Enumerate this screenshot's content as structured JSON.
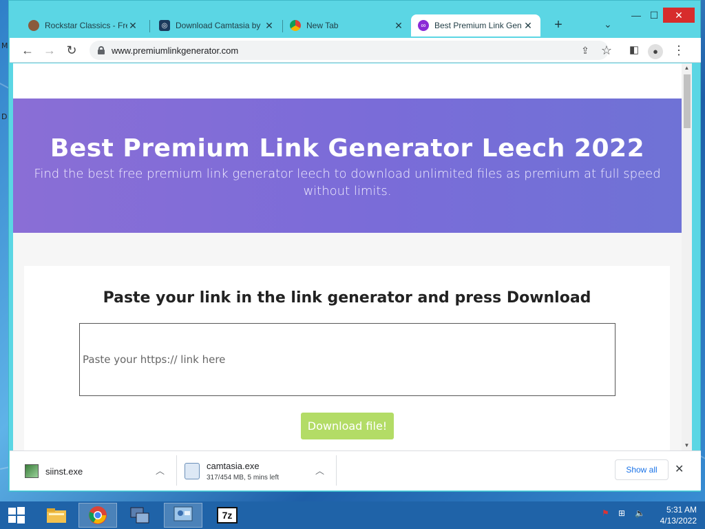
{
  "desktop": {
    "edge_labels": [
      "M",
      "D"
    ]
  },
  "browser": {
    "tabs": [
      {
        "title": "Rockstar Classics - Free",
        "icon": "rockstar-avatar-icon",
        "active": false
      },
      {
        "title": "Download Camtasia by",
        "icon": "camtasia-icon",
        "active": false
      },
      {
        "title": "New Tab",
        "icon": "chrome-icon",
        "active": false
      },
      {
        "title": "Best Premium Link Gen",
        "icon": "link-generator-icon",
        "active": true
      }
    ],
    "new_tab_symbol": "+",
    "tab_menu_symbol": "⌄",
    "window_controls": {
      "minimize": "—",
      "maximize": "☐",
      "close": "✕"
    },
    "address": "www.premiumlinkgenerator.com",
    "toolbar_icons": [
      "back-icon",
      "forward-icon",
      "reload-icon",
      "share-icon",
      "bookmark-star-icon",
      "side-panel-icon",
      "profile-icon",
      "menu-icon"
    ]
  },
  "page": {
    "hero_title": "Best Premium Link Generator Leech 2022",
    "hero_subtitle": "Find the best free premium link generator leech to download unlimited files as premium at full speed without limits.",
    "form_heading": "Paste your link in the link generator and press Download",
    "input_placeholder": "Paste your https:// link here",
    "download_button": "Download file!",
    "colors": {
      "hero_start": "#8a6ed6",
      "hero_end": "#6f72d6",
      "button": "#b3dc66"
    }
  },
  "downloads": {
    "items": [
      {
        "name": "siinst.exe",
        "status": "",
        "icon": "installer-icon"
      },
      {
        "name": "camtasia.exe",
        "status": "317/454 MB, 5 mins left",
        "icon": "camtasia-file-icon"
      }
    ],
    "show_all": "Show all",
    "close_symbol": "✕"
  },
  "taskbar": {
    "apps": [
      "windows-start-icon",
      "file-explorer-icon",
      "chrome-taskbar-icon",
      "network-setup-icon",
      "control-panel-icon",
      "7zip-icon"
    ],
    "sevenzip_label": "7z",
    "clock_time": "5:31 AM",
    "clock_date": "4/13/2022"
  }
}
